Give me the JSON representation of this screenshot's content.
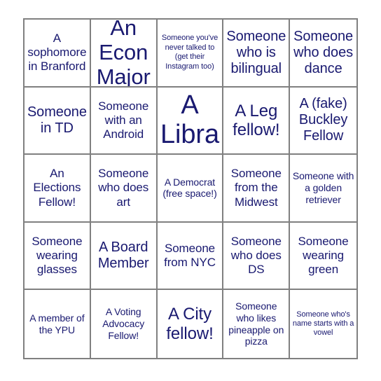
{
  "card": {
    "type": "bingo-card",
    "rows": 5,
    "columns": 5,
    "text_color": "#191970",
    "border_color": "#808080",
    "background_color": "#ffffff",
    "free_space_index": 12,
    "cells": [
      {
        "text": "A sophomore in Branford",
        "size": "fs-m"
      },
      {
        "text": "An Econ Major",
        "size": "fs-xxl"
      },
      {
        "text": "Someone you've never talked to (get their Instagram too)",
        "size": "fs-xs"
      },
      {
        "text": "Someone who is bilingual",
        "size": "fs-l"
      },
      {
        "text": "Someone who does dance",
        "size": "fs-l"
      },
      {
        "text": "Someone in TD",
        "size": "fs-l"
      },
      {
        "text": "Someone with an Android",
        "size": "fs-m"
      },
      {
        "text": "A Libra",
        "size": "fs-huge"
      },
      {
        "text": "A Leg fellow!",
        "size": "fs-xl"
      },
      {
        "text": "A (fake) Buckley Fellow",
        "size": "fs-l"
      },
      {
        "text": "An Elections Fellow!",
        "size": "fs-m"
      },
      {
        "text": "Someone who does art",
        "size": "fs-m"
      },
      {
        "text": "A Democrat (free space!)",
        "size": "fs-s"
      },
      {
        "text": "Someone from the Midwest",
        "size": "fs-m"
      },
      {
        "text": "Someone with a golden retriever",
        "size": "fs-s"
      },
      {
        "text": "Someone wearing glasses",
        "size": "fs-m"
      },
      {
        "text": "A Board Member",
        "size": "fs-l"
      },
      {
        "text": "Someone from NYC",
        "size": "fs-m"
      },
      {
        "text": "Someone who does DS",
        "size": "fs-m"
      },
      {
        "text": "Someone wearing green",
        "size": "fs-m"
      },
      {
        "text": "A member of the YPU",
        "size": "fs-s"
      },
      {
        "text": "A Voting Advocacy Fellow!",
        "size": "fs-s"
      },
      {
        "text": "A City fellow!",
        "size": "fs-xl"
      },
      {
        "text": "Someone who likes pineapple on pizza",
        "size": "fs-s"
      },
      {
        "text": "Someone who's name starts with a vowel",
        "size": "fs-xs"
      }
    ]
  }
}
